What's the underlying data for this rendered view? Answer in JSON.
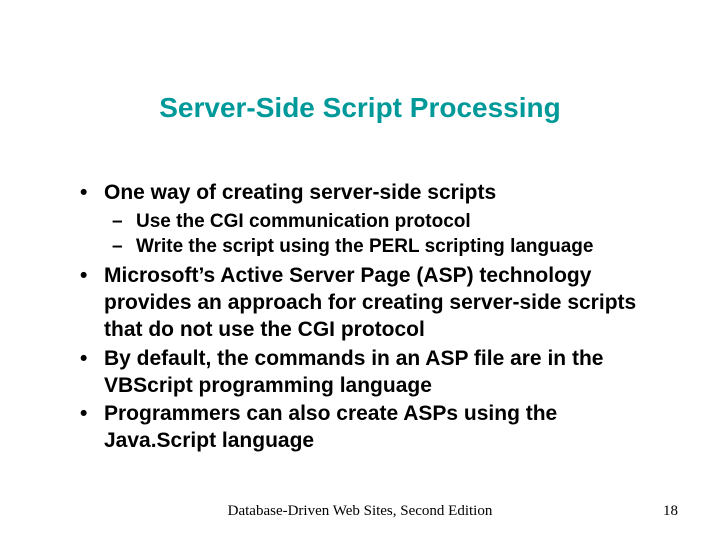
{
  "title": "Server-Side Script Processing",
  "bullets": {
    "b0": "One way of creating server-side scripts",
    "b0_sub0": "Use the CGI communication protocol",
    "b0_sub1": "Write the script using the PERL scripting language",
    "b1": "Microsoft’s Active Server Page (ASP) technology provides an approach for creating server-side scripts that do not use the CGI protocol",
    "b2": "By default, the commands in an ASP file are in the VBScript programming language",
    "b3": "Programmers can also create ASPs using the Java.Script language"
  },
  "footer": {
    "source": "Database-Driven Web Sites, Second Edition",
    "page": "18"
  }
}
